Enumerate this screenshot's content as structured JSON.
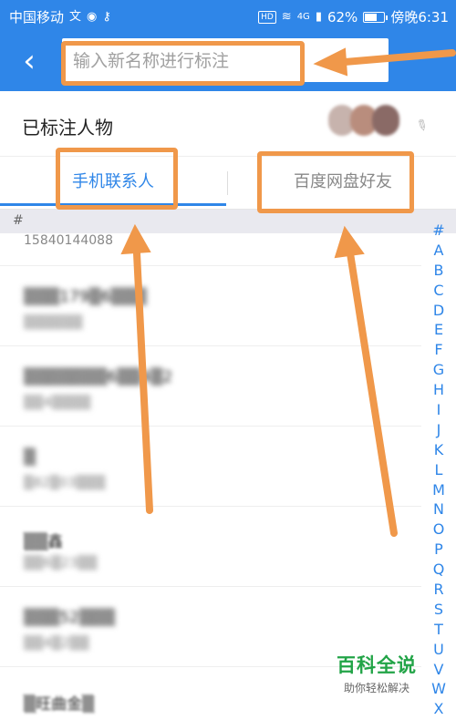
{
  "status_bar": {
    "carrier": "中国移动",
    "signal_label": "4G",
    "battery": "62%",
    "battery_level": 0.62,
    "time": "傍晚6:31",
    "hd_label": "HD"
  },
  "app_bar": {
    "back_icon": "chevron-left-icon",
    "search_placeholder": "输入新名称进行标注",
    "accent_color": "#2f86e8"
  },
  "tagged": {
    "label": "已标注人物"
  },
  "tabs": [
    {
      "label": "手机联系人",
      "active": true
    },
    {
      "label": "百度网盘好友",
      "active": false
    }
  ],
  "section_header": "#",
  "contacts": [
    {
      "name": "",
      "phone": "15840144088"
    },
    {
      "name": "▒▒▒179▒6▒▒▒",
      "phone": "▒▒▒▒▒▒"
    },
    {
      "name": "▒▒▒▒▒▒▒6▒▒4▒2",
      "phone": "▒▒4▒▒▒▒"
    },
    {
      "name": "▒",
      "phone": "▒82▒03▒▒▒"
    },
    {
      "name": "▒▒鑫",
      "phone": "▒▒6▒23▒▒"
    },
    {
      "name": "▒▒▒52▒▒▒",
      "phone": "▒▒4▒2▒▒"
    },
    {
      "name": "▒旺曲金▒",
      "phone": ""
    }
  ],
  "index_letters": [
    "#",
    "A",
    "B",
    "C",
    "D",
    "E",
    "F",
    "G",
    "H",
    "I",
    "J",
    "K",
    "L",
    "M",
    "N",
    "O",
    "P",
    "Q",
    "R",
    "S",
    "T",
    "U",
    "V",
    "W",
    "X"
  ],
  "watermark": {
    "title": "百科全说",
    "subtitle": "助你轻松解决"
  },
  "annotation_color": "#f0984a"
}
